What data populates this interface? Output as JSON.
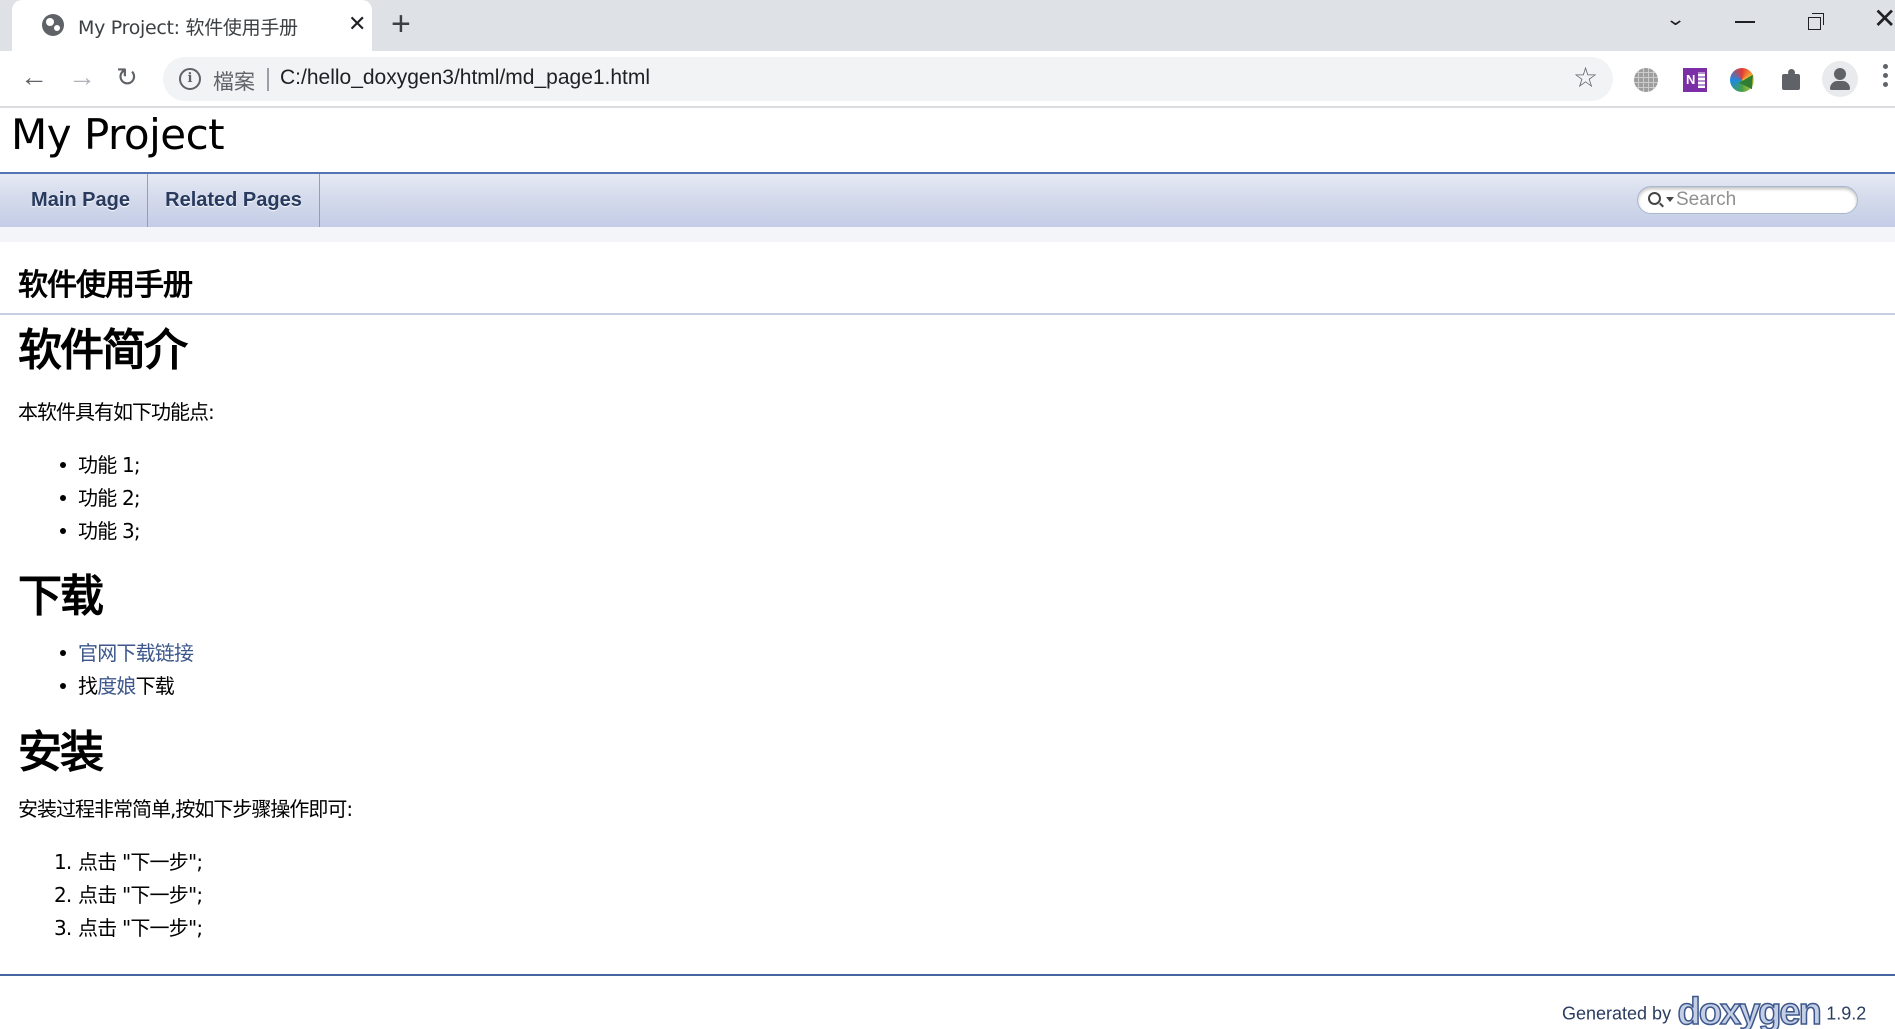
{
  "browser": {
    "tab": {
      "favicon": "globe-icon",
      "title": "My Project: 软件使用手册",
      "close_glyph": "✕"
    },
    "new_tab_glyph": "+",
    "window_controls": {
      "dropdown_glyph": "⌄",
      "close_glyph": "✕"
    },
    "nav": {
      "back_glyph": "←",
      "forward_glyph": "→",
      "reload_glyph": "↻"
    },
    "omnibox": {
      "info_glyph": "i",
      "security_label": "檔案",
      "url": "C:/hello_doxygen3/html/md_page1.html",
      "star_glyph": "☆"
    },
    "extensions": [
      "globe-extension",
      "onenote-extension",
      "idm-extension",
      "extensions-puzzle"
    ],
    "onenote_letter": "N"
  },
  "doxygen": {
    "project_name": "My Project",
    "nav_tabs": [
      {
        "label": "Main Page"
      },
      {
        "label": "Related Pages"
      }
    ],
    "search": {
      "placeholder": "Search",
      "value": ""
    },
    "page_title": "软件使用手册",
    "sections": [
      {
        "heading": "软件简介",
        "intro": "本软件具有如下功能点:",
        "items": [
          "功能 1;",
          "功能 2;",
          "功能 3;"
        ]
      },
      {
        "heading": "下载",
        "items": [
          {
            "link": "官网下载链接"
          },
          {
            "prefix": "找",
            "link": "度娘",
            "suffix": "下载"
          }
        ]
      },
      {
        "heading": "安装",
        "intro": "安装过程非常简单,按如下步骤操作即可:",
        "steps": [
          {
            "num": "1.",
            "text": "点击 \"下一步\";"
          },
          {
            "num": "2.",
            "text": "点击 \"下一步\";"
          },
          {
            "num": "3.",
            "text": "点击 \"下一步\";"
          }
        ]
      }
    ],
    "footer": {
      "generated_by": "Generated by",
      "logo_text": "doxygen",
      "version": "1.9.2"
    },
    "colors": {
      "link": "#3d578c",
      "nav_border": "#5373b4",
      "nav_text": "#283a5d",
      "footer_line": "#4665a2"
    }
  }
}
